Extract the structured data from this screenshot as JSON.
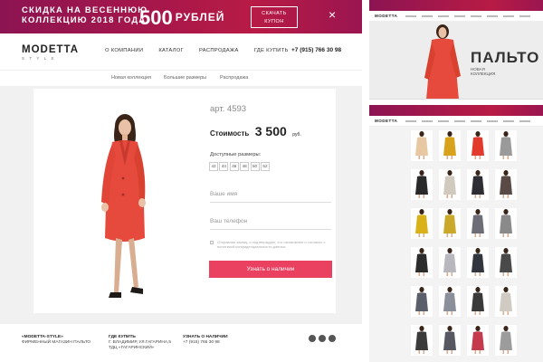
{
  "promo": {
    "line1": "СКИДКА НА ВЕСЕННЮЮ",
    "line2": "КОЛЛЕКЦИЮ 2018 ГОДА",
    "amount": "500",
    "currency": "РУБЛЕЙ",
    "coupon_line1": "СКАЧАТЬ",
    "coupon_line2": "КУПОН",
    "close": "×"
  },
  "logo": {
    "main": "MODETTA",
    "sub": "STYLE"
  },
  "nav": [
    "О КОМПАНИИ",
    "КАТАЛОГ",
    "РАСПРОДАЖА",
    "ГДЕ КУПИТЬ"
  ],
  "phone": "+7 (915) 766 30 98",
  "subnav": [
    "Новая коллекция",
    "Большие размеры",
    "Распродажа"
  ],
  "product": {
    "sku": "арт. 4593",
    "price_label": "Стоимость",
    "price": "3 500",
    "currency": "руб.",
    "sizes_label": "Доступные размеры:",
    "sizes": [
      "42",
      "44",
      "46",
      "48",
      "50",
      "52"
    ],
    "name_placeholder": "Ваше имя",
    "phone_placeholder": "Ваш телефон",
    "consent": "Отправляя заявку, я подтверждаю, что ознакомлен и согласен с политикой конфиденциальности данных",
    "cta": "Узнать о наличии"
  },
  "footer": {
    "col1_title": "«MODETTA-STYLE»",
    "col1_text": "ФИРМЕННЫЙ МАГАЗИН ПАЛЬТО",
    "col2_title": "ГДЕ КУПИТЬ",
    "col2_line1": "Г. ВЛАДИМИР, УЛ.ГАГАРИНА,5",
    "col2_line2": "ТДЦ «ГАГАРИНСКИЙ»",
    "col3_title": "УЗНАТЬ О НАЛИЧИИ",
    "col3_text": "+7 (915) 766 30 98",
    "social": [
      "vk-icon",
      "instagram-icon",
      "facebook-icon"
    ]
  },
  "preview_home": {
    "logo": "MODETTA",
    "hero_title": "ПАЛЬТО",
    "hero_sub1": "НОВАЯ",
    "hero_sub2": "КОЛЛЕКЦИЯ"
  },
  "preview_catalog": {
    "logo": "MODETTA",
    "coat_colors": [
      "#e8c7a3",
      "#d9a21c",
      "#e23b2e",
      "#9a9a9a",
      "#2a2a2a",
      "#cfc9be",
      "#2d2d33",
      "#5a4a46",
      "#d9b21a",
      "#c9a82a",
      "#6d6d78",
      "#8a8a8a",
      "#2c2c2c",
      "#b7b7bd",
      "#31363e",
      "#4a4a4a",
      "#5b5f6b",
      "#8b8f99",
      "#3a3a3a",
      "#d0cbc2",
      "#3b3b3b",
      "#585862",
      "#c33b4d",
      "#9c9c9c"
    ]
  },
  "colors": {
    "accent": "#eb4161",
    "promo": "#a8174a",
    "coat": "#e64a3d"
  }
}
